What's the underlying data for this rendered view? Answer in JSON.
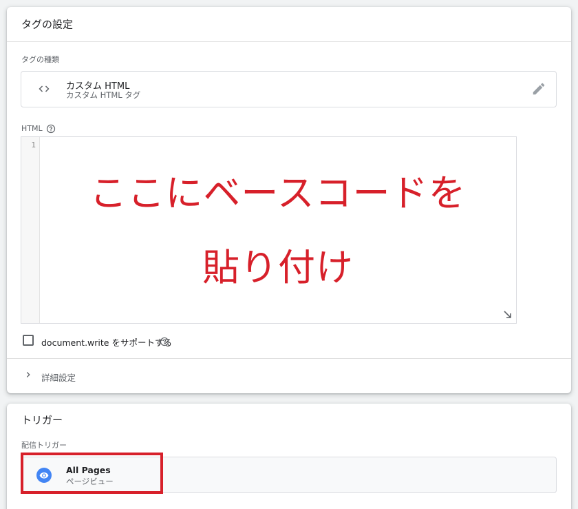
{
  "tag_card": {
    "title": "タグの設定",
    "type_label": "タグの種類",
    "type": {
      "name": "カスタム HTML",
      "subtitle": "カスタム HTML タグ",
      "icon": "code-icon",
      "edit_icon": "pencil-icon"
    },
    "html_label": "HTML",
    "editor": {
      "line_number": "1",
      "value": ""
    },
    "overlay_line1": "ここにベースコードを",
    "overlay_line2": "貼り付け",
    "checkbox_label": "document.write をサポートする",
    "checkbox_checked": false,
    "advanced_label": "詳細設定"
  },
  "trigger_card": {
    "title": "トリガー",
    "firing_label": "配信トリガー",
    "trigger": {
      "name": "All Pages",
      "subtitle": "ページビュー",
      "icon": "eye-icon"
    }
  },
  "colors": {
    "annotation_red": "#d7202a",
    "trigger_icon_blue": "#4285f4"
  }
}
